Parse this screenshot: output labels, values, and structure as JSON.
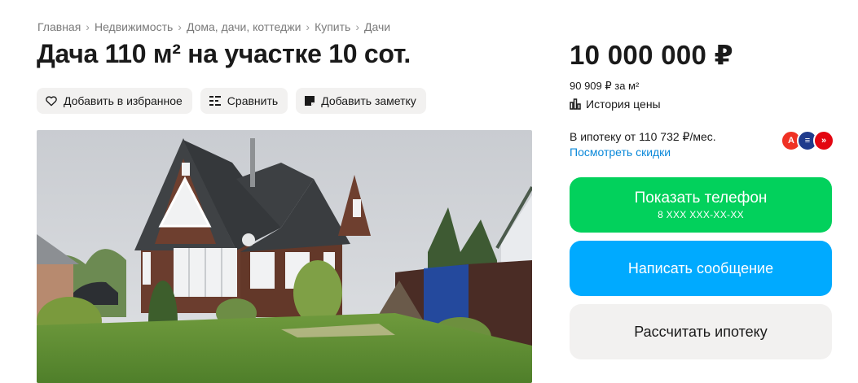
{
  "breadcrumbs": [
    "Главная",
    "Недвижимость",
    "Дома, дачи, коттеджи",
    "Купить",
    "Дачи"
  ],
  "title": "Дача 110 м² на участке 10 сот.",
  "actions": {
    "favorite": "Добавить в избранное",
    "compare": "Сравнить",
    "note": "Добавить заметку"
  },
  "price": {
    "total": "10 000 000 ₽",
    "per_sqm": "90 909 ₽ за м²",
    "history": "История цены"
  },
  "mortgage": {
    "text": "В ипотеку от 110 732 ₽/мес.",
    "link": "Посмотреть скидки",
    "banks": [
      {
        "icon": "alfa-bank-icon",
        "letter": "A",
        "color": "#ef3124"
      },
      {
        "icon": "bank-blue-icon",
        "letter": "≡",
        "color": "#1f3b8c"
      },
      {
        "icon": "bank-red-icon",
        "letter": "»",
        "color": "#e30611"
      }
    ]
  },
  "buttons": {
    "show_phone": "Показать телефон",
    "phone_mask": "8 XXX XXX-XX-XX",
    "message": "Написать сообщение",
    "calc_mortgage": "Рассчитать ипотеку"
  },
  "colors": {
    "green": "#02d15c",
    "blue": "#00aaff",
    "link": "#0a88d9",
    "gray_button": "#f2f1f0"
  }
}
